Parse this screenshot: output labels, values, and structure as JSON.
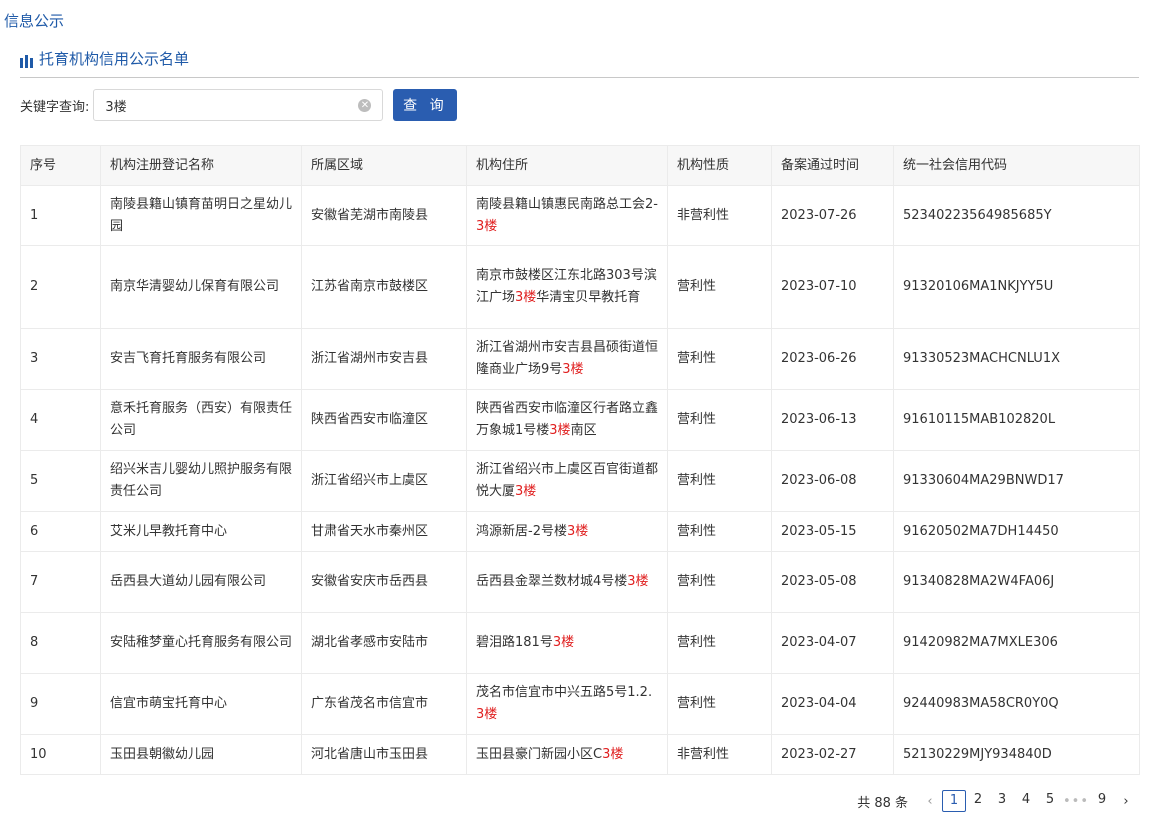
{
  "header": {
    "title": "信息公示"
  },
  "section": {
    "title": "托育机构信用公示名单",
    "icon": "bar-list-icon"
  },
  "search": {
    "label": "关键字查询:",
    "value": "3楼",
    "button_label": "查 询",
    "highlight_term": "3楼"
  },
  "table": {
    "columns": [
      "序号",
      "机构注册登记名称",
      "所属区域",
      "机构住所",
      "机构性质",
      "备案通过时间",
      "统一社会信用代码"
    ],
    "rows": [
      {
        "no": "1",
        "name": "南陵县籍山镇育苗明日之星幼儿园",
        "region": "安徽省芜湖市南陵县",
        "address": "南陵县籍山镇惠民南路总工会2-3楼",
        "type": "非营利性",
        "date": "2023-07-26",
        "code": "52340223564985685Y"
      },
      {
        "no": "2",
        "name": "南京华清婴幼儿保育有限公司",
        "region": "江苏省南京市鼓楼区",
        "address": "南京市鼓楼区江东北路303号滨江广场3楼华清宝贝早教托育",
        "type": "营利性",
        "date": "2023-07-10",
        "code": "91320106MA1NKJYY5U"
      },
      {
        "no": "3",
        "name": "安吉飞育托育服务有限公司",
        "region": "浙江省湖州市安吉县",
        "address": "浙江省湖州市安吉县昌硕街道恒隆商业广场9号3楼",
        "type": "营利性",
        "date": "2023-06-26",
        "code": "91330523MACHCNLU1X"
      },
      {
        "no": "4",
        "name": "意禾托育服务（西安）有限责任公司",
        "region": "陕西省西安市临潼区",
        "address": "陕西省西安市临潼区行者路立鑫万象城1号楼3楼南区",
        "type": "营利性",
        "date": "2023-06-13",
        "code": "91610115MAB102820L"
      },
      {
        "no": "5",
        "name": "绍兴米吉儿婴幼儿照护服务有限责任公司",
        "region": "浙江省绍兴市上虞区",
        "address": "浙江省绍兴市上虞区百官街道都悦大厦3楼",
        "type": "营利性",
        "date": "2023-06-08",
        "code": "91330604MA29BNWD17"
      },
      {
        "no": "6",
        "name": "艾米儿早教托育中心",
        "region": "甘肃省天水市秦州区",
        "address": "鸿源新居-2号楼3楼",
        "type": "营利性",
        "date": "2023-05-15",
        "code": "91620502MA7DH14450"
      },
      {
        "no": "7",
        "name": "岳西县大道幼儿园有限公司",
        "region": "安徽省安庆市岳西县",
        "address": "岳西县金翠兰数材城4号楼3楼",
        "type": "营利性",
        "date": "2023-05-08",
        "code": "91340828MA2W4FA06J"
      },
      {
        "no": "8",
        "name": "安陆稚梦童心托育服务有限公司",
        "region": "湖北省孝感市安陆市",
        "address": "碧泪路181号3楼",
        "type": "营利性",
        "date": "2023-04-07",
        "code": "91420982MA7MXLE306"
      },
      {
        "no": "9",
        "name": "信宜市萌宝托育中心",
        "region": "广东省茂名市信宜市",
        "address": "茂名市信宜市中兴五路5号1.2.3楼",
        "type": "营利性",
        "date": "2023-04-04",
        "code": "92440983MA58CR0Y0Q"
      },
      {
        "no": "10",
        "name": "玉田县朝徽幼儿园",
        "region": "河北省唐山市玉田县",
        "address": "玉田县豪门新园小区C3楼",
        "type": "非营利性",
        "date": "2023-02-27",
        "code": "52130229MJY934840D"
      }
    ]
  },
  "pagination": {
    "total_label": "共 88 条",
    "pages": [
      "1",
      "2",
      "3",
      "4",
      "5"
    ],
    "ellipsis": "•••",
    "last_page": "9",
    "current": "1",
    "prev_icon": "chevron-left-icon",
    "next_icon": "chevron-right-icon"
  },
  "colors": {
    "accent": "#2a5db0",
    "title_blue": "#1f5aa8",
    "highlight": "#e02020"
  }
}
